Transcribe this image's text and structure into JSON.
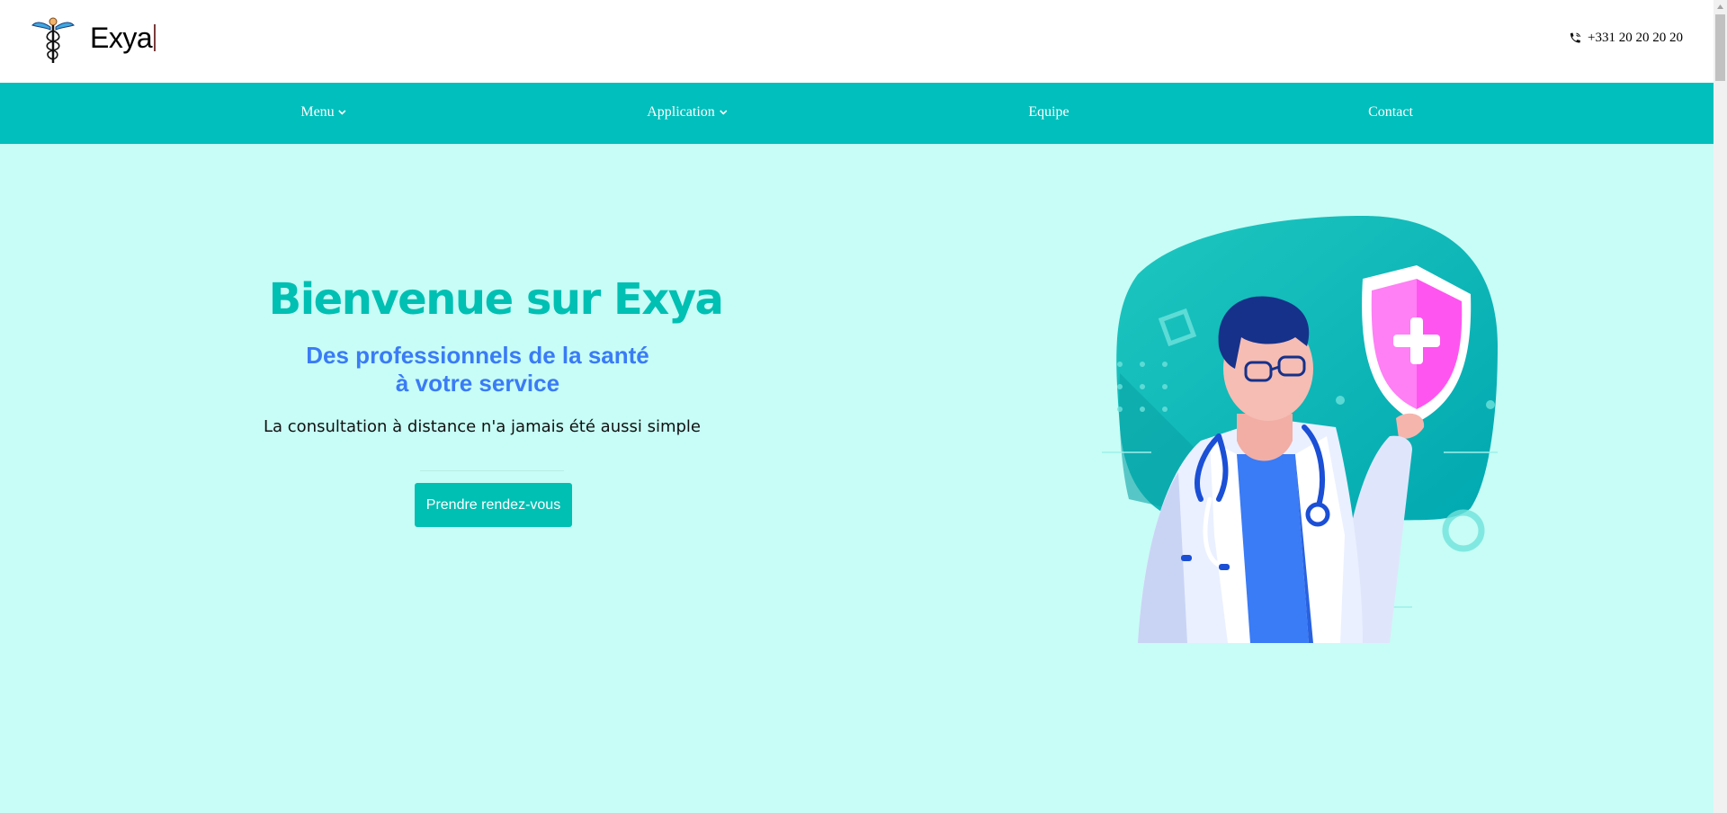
{
  "header": {
    "brand": "Exya",
    "logo_icon": "caduceus-icon",
    "phone_icon": "phone-icon",
    "phone": "+331 20 20 20 20"
  },
  "nav": {
    "items": [
      {
        "label": "Menu",
        "has_dropdown": true
      },
      {
        "label": "Application",
        "has_dropdown": true
      },
      {
        "label": "Equipe",
        "has_dropdown": false
      },
      {
        "label": "Contact",
        "has_dropdown": false
      }
    ]
  },
  "hero": {
    "title": "Bienvenue sur Exya",
    "subtitle_line1": "Des professionnels de la santé",
    "subtitle_line2": "à votre service",
    "text": "La consultation à distance n'a jamais été aussi simple",
    "cta_label": "Prendre rendez-vous",
    "illustration": "doctor-with-shield-illustration"
  },
  "colors": {
    "accent": "#00bfbc",
    "hero_background": "#c7fdf6",
    "title": "#00bfb3",
    "subtitle": "#3a7bf6",
    "shield": "#ff6bf4"
  }
}
